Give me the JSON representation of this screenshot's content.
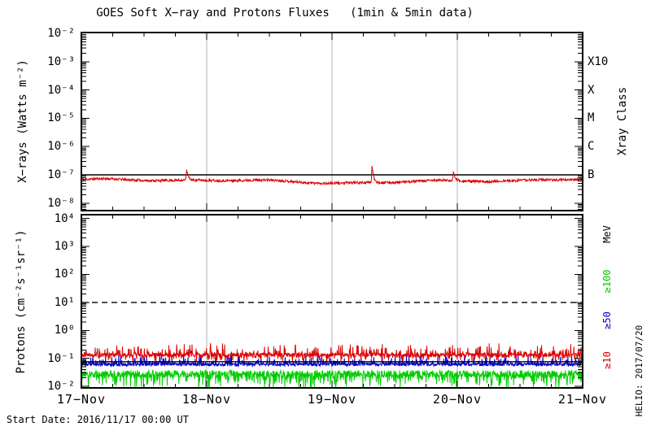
{
  "title": "GOES Soft X−ray and Protons Fluxes   (1min & 5min data)",
  "start_date_note": "Start Date: 2016/11/17 00:00 UT",
  "credit": "HELIO: 2017/07/20",
  "colors": {
    "xray": "#dd0000",
    "protons_ge10": "#dd0000",
    "protons_ge50": "#0000cc",
    "protons_ge100": "#00cc00",
    "grid": "#b4b4b4",
    "frame": "#000000"
  },
  "chart_data": [
    {
      "type": "line",
      "panel": "xray",
      "title": "GOES Soft X−ray and Protons Fluxes   (1min & 5min data)",
      "ylabel": "X−rays (Watts m⁻²)",
      "xlabel": "",
      "x_categories": [
        "17−Nov",
        "18−Nov",
        "19−Nov",
        "20−Nov",
        "21−Nov"
      ],
      "x_span_days": 4,
      "x_minor_tick_hours": 6,
      "grid_days": [
        1,
        2,
        3
      ],
      "grid_color": "#b4b4b4",
      "ylim_log10": [
        -8.26,
        -1.97
      ],
      "yticks": [
        {
          "label": "10⁻²",
          "exp": -2
        },
        {
          "label": "10⁻³",
          "exp": -3
        },
        {
          "label": "10⁻⁴",
          "exp": -4
        },
        {
          "label": "10⁻⁵",
          "exp": -5
        },
        {
          "label": "10⁻⁶",
          "exp": -6
        },
        {
          "label": "10⁻⁷",
          "exp": -7
        },
        {
          "label": "10⁻⁸",
          "exp": -8
        }
      ],
      "right_axis": {
        "title": "Xray Class",
        "labels": [
          {
            "text": "X10",
            "exp": -3
          },
          {
            "text": "X",
            "exp": -4
          },
          {
            "text": "M",
            "exp": -5
          },
          {
            "text": "C",
            "exp": -6
          },
          {
            "text": "B",
            "exp": -7
          }
        ]
      },
      "reference_lines": [
        {
          "log10": -7,
          "style": "solid",
          "color": "#000000",
          "value": "1e-7 W m⁻²"
        }
      ],
      "series": [
        {
          "id": "xray-flux",
          "name": "GOES X−ray flux",
          "color": "#dd0000",
          "samples": 1300,
          "baseline_log10": -7.22,
          "typical_flux": "6e-8 to 8e-8 W m⁻²",
          "jitter_log10": 0.09,
          "wander": [
            {
              "amp": 0.05,
              "freq": 1.9,
              "phase": 0.5
            },
            {
              "amp": 0.03,
              "freq": 4.7,
              "phase": 1.2
            },
            {
              "amp": 0.018,
              "freq": 9.3,
              "phase": 0.0
            }
          ],
          "flares": [
            {
              "day": 0.84,
              "peak_log10": -6.87,
              "peak_flux": "1.3e-7 (B1.3)",
              "time": "17−Nov ~20:00 UT"
            },
            {
              "day": 2.32,
              "peak_log10": -6.64,
              "peak_flux": "2.3e-7 (B2.3)",
              "time": "19−Nov ~07:40 UT"
            },
            {
              "day": 2.97,
              "peak_log10": -6.93,
              "peak_flux": "1.2e-7 (B1.2)",
              "time": "19−Nov ~23:15 UT"
            }
          ]
        }
      ]
    },
    {
      "type": "line",
      "panel": "protons",
      "ylabel": "Protons (cm⁻²s⁻¹sr⁻¹)",
      "xlabel": "",
      "x_span_days": 4,
      "x_minor_tick_hours": 6,
      "grid_days": [
        1,
        2,
        3
      ],
      "grid_color": "#b4b4b4",
      "ylim_log10": [
        -2.06,
        4.14
      ],
      "yticks": [
        {
          "label": "10⁴",
          "exp": 4
        },
        {
          "label": "10³",
          "exp": 3
        },
        {
          "label": "10²",
          "exp": 2
        },
        {
          "label": "10¹",
          "exp": 1
        },
        {
          "label": "10⁰",
          "exp": 0
        },
        {
          "label": "10⁻¹",
          "exp": -1
        },
        {
          "label": "10⁻²",
          "exp": -2
        }
      ],
      "right_axis": {
        "title": "MeV",
        "labels": [
          {
            "text": "≥100",
            "color": "#00cc00"
          },
          {
            "text": "≥50",
            "color": "#0000cc"
          },
          {
            "text": "≥10",
            "color": "#dd0000"
          }
        ]
      },
      "reference_lines": [
        {
          "log10": 1,
          "style": "dashed",
          "color": "#000000",
          "value": "1e+1 (≥10 MeV event threshold)"
        },
        {
          "log10": -1.12,
          "style": "solid",
          "color": "#000000",
          "value": "~7.5e-2"
        }
      ],
      "series": [
        {
          "id": "protons-ge100mev",
          "name": "Protons ≥100 MeV",
          "color": "#00cc00",
          "samples": 1600,
          "baseline_log10": -1.55,
          "typical_flux": "~3e-2",
          "jitter_log10": 0.26,
          "down_spike": {
            "amp": 0.5,
            "pow": 7
          }
        },
        {
          "id": "protons-ge50mev",
          "name": "Protons ≥50 MeV",
          "color": "#0000cc",
          "samples": 1600,
          "baseline_log10": -1.22,
          "typical_flux": "~6e-2",
          "jitter_log10": 0.12,
          "up_spike": {
            "amp": 0.32,
            "pow": 8
          }
        },
        {
          "id": "protons-ge10mev",
          "name": "Protons ≥10 MeV",
          "color": "#dd0000",
          "samples": 1600,
          "baseline_log10": -0.88,
          "typical_flux": "~1.3e-1",
          "jitter_log10": 0.14,
          "up_spike": {
            "amp": 0.4,
            "pow": 9
          },
          "down_spike": {
            "amp": 0.25,
            "pow": 12
          }
        }
      ]
    }
  ]
}
